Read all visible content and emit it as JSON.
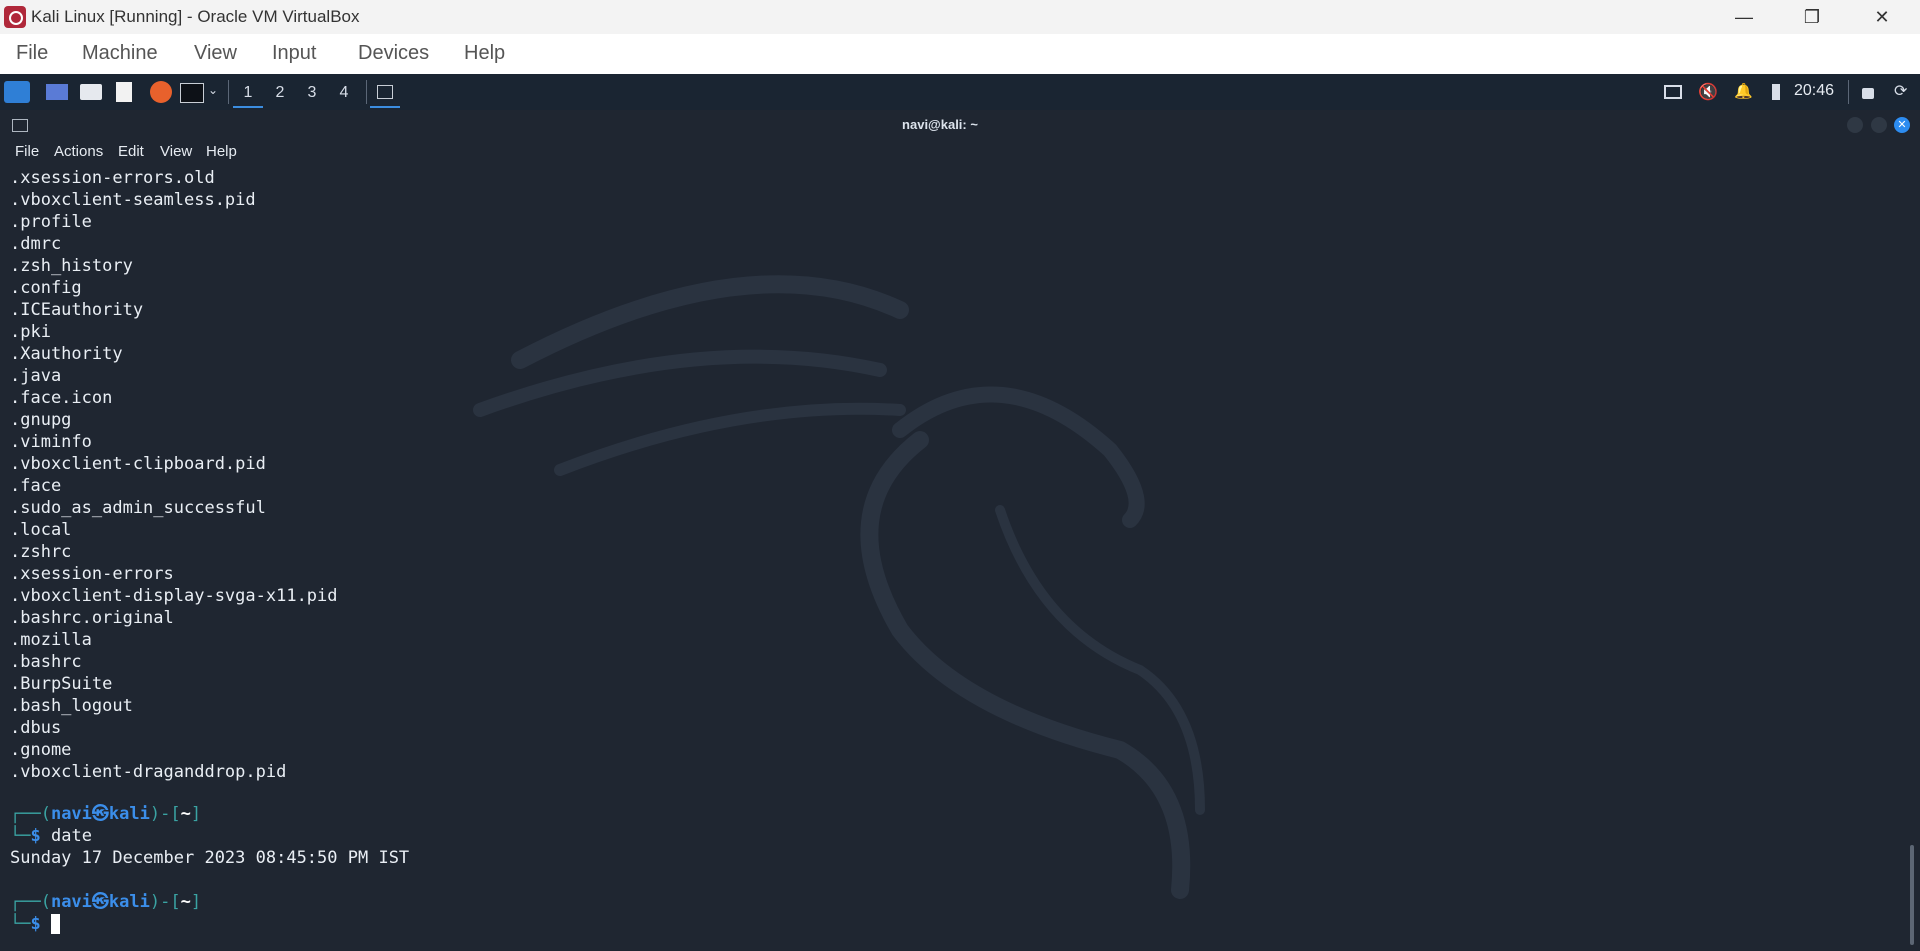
{
  "window": {
    "title": "Kali Linux [Running] - Oracle VM VirtualBox",
    "minimize_glyph": "—",
    "restore_glyph": "❐",
    "close_glyph": "✕"
  },
  "vbox_menu": [
    "File",
    "Machine",
    "View",
    "Input",
    "Devices",
    "Help"
  ],
  "panel": {
    "workspaces": [
      "1",
      "2",
      "3",
      "4"
    ],
    "active_workspace": 1,
    "clock": "20:46",
    "icons": [
      "kali-menu-icon",
      "desktop-icon",
      "file-manager-icon",
      "text-editor-icon",
      "firefox-icon",
      "terminal-icon",
      "chevron-down-icon",
      "terminal-task-icon",
      "display-icon",
      "muted-speaker-icon",
      "notification-bell-icon",
      "battery-icon",
      "lock-icon",
      "power-icon"
    ]
  },
  "terminal": {
    "title": "navi@kali: ~",
    "menu": [
      "File",
      "Actions",
      "Edit",
      "View",
      "Help"
    ],
    "files": [
      ".xsession-errors.old",
      ".vboxclient-seamless.pid",
      ".profile",
      ".dmrc",
      ".zsh_history",
      ".config",
      ".ICEauthority",
      ".pki",
      ".Xauthority",
      ".java",
      ".face.icon",
      ".gnupg",
      ".viminfo",
      ".vboxclient-clipboard.pid",
      ".face",
      ".sudo_as_admin_successful",
      ".local",
      ".zshrc",
      ".xsession-errors",
      ".vboxclient-display-svga-x11.pid",
      ".bashrc.original",
      ".mozilla",
      ".bashrc",
      ".BurpSuite",
      ".bash_logout",
      ".dbus",
      ".gnome",
      ".vboxclient-draganddrop.pid"
    ],
    "prompt": {
      "open": "┌──(",
      "user": "navi",
      "at": "㉿",
      "host": "kali",
      "close": ")-[",
      "dir": "~",
      "end": "]",
      "corner": "└─",
      "dollar": "$"
    },
    "command": "date",
    "output": "Sunday 17 December 2023 08:45:50 PM IST"
  }
}
